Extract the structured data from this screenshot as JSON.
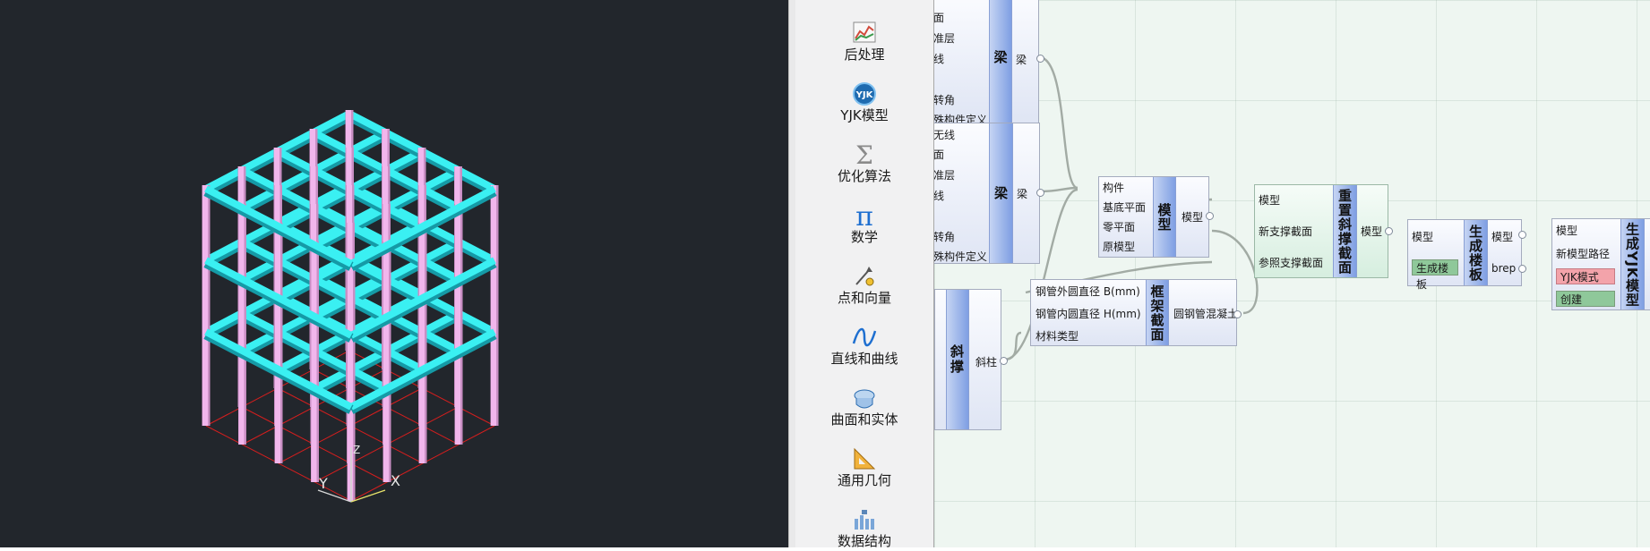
{
  "viewport": {
    "axis_labels": {
      "x": "X",
      "y": "Y",
      "z": "Z"
    },
    "colors": {
      "background": "#22262c",
      "beam": "#3af0f2",
      "column": "#f1b6ec",
      "grid": "#d41e1e"
    }
  },
  "toolbox": {
    "items": [
      {
        "label": "后处理",
        "icon": "chart-icon"
      },
      {
        "label": "YJK模型",
        "icon": "yjk-logo-icon"
      },
      {
        "label": "优化算法",
        "icon": "sigma-icon"
      },
      {
        "label": "数学",
        "icon": "pi-icon"
      },
      {
        "label": "点和向量",
        "icon": "point-vector-icon"
      },
      {
        "label": "直线和曲线",
        "icon": "curve-icon"
      },
      {
        "label": "曲面和实体",
        "icon": "surface-solid-icon"
      },
      {
        "label": "通用几何",
        "icon": "triangle-ruler-icon"
      },
      {
        "label": "数据结构",
        "icon": "data-structure-icon"
      }
    ]
  },
  "canvas": {
    "beam1": {
      "title": "梁",
      "inputs": [
        "面",
        "准层",
        "线",
        "",
        "转角",
        "殊构件定义"
      ],
      "output": "梁"
    },
    "beam2": {
      "title": "梁",
      "inputs": [
        "无线",
        "面",
        "准层",
        "线",
        "",
        "转角",
        "殊构件定义"
      ],
      "output": "梁"
    },
    "brace": {
      "title": "斜撑",
      "output": "斜柱"
    },
    "model": {
      "title": "模型",
      "inputs": [
        "构件",
        "基底平面",
        "零平面",
        "原模型"
      ],
      "output": "模型"
    },
    "frame_section": {
      "title": "框架截面",
      "inputs": [
        "钢管外圆直径 B(mm)",
        "钢管内圆直径 H(mm)",
        "材料类型"
      ],
      "output": "圆钢管混凝土"
    },
    "reset_brace": {
      "title": "重置斜撑截面",
      "inputs": [
        "模型",
        "新支撑截面",
        "参照支撑截面"
      ],
      "output": "模型"
    },
    "gen_slab": {
      "title": "生成楼板",
      "inputs": [
        "模型"
      ],
      "chip": "生成楼板",
      "outputs": [
        "模型",
        "brep"
      ]
    },
    "gen_yjk": {
      "title": "生成YJK模型",
      "inputs": [
        "模型",
        "新模型路径"
      ],
      "chips": [
        "YJK模式",
        "创建"
      ]
    }
  }
}
